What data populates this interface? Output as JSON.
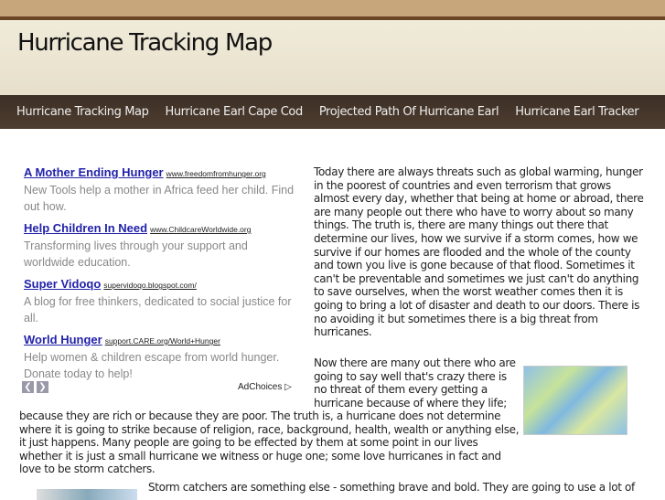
{
  "site": {
    "title": "Hurricane Tracking Map"
  },
  "nav": [
    "Hurricane Tracking Map",
    "Hurricane Earl Cape Cod",
    "Projected Path Of Hurricane Earl",
    "Hurricane Earl Tracker"
  ],
  "ads": [
    {
      "title": "A Mother Ending Hunger",
      "url": "www.freedomfromhunger.org",
      "desc": "New Tools help a mother in Africa feed her child. Find out how."
    },
    {
      "title": "Help Children In Need",
      "url": "www.ChildcareWorldwide.org",
      "desc": "Transforming lives through your support and worldwide education."
    },
    {
      "title": "Super Vidoqo",
      "url": "supervidoqo.blogspot.com/",
      "desc": "A blog for free thinkers, dedicated to social justice for all."
    },
    {
      "title": "World Hunger",
      "url": "support.CARE.org/World+Hunger",
      "desc": "Help women & children escape from world hunger. Donate today to help!"
    }
  ],
  "adchoices": "AdChoices",
  "article": {
    "p1": "Today there are always threats such as global warming, hunger in the poorest of countries and even terrorism that grows almost every day, whether that being at home or abroad, there are many people out there who have to worry about so many things. The truth is, there are many things out there that determine our lives, how we survive if a storm comes, how we survive if our homes are flooded and the whole of the county and town you live is gone because of that flood. Sometimes it can't be preventable and sometimes we just can't do anything to save ourselves, when the worst weather comes then it is going to bring a lot of disaster and death to our doors. There is no avoiding it but sometimes there is a big threat from hurricanes.",
    "p2a": "Now there are many out there who are going to say well that's crazy there is no threat of them every getting a hurricane because of where they life;",
    "p2b": "because they are rich or because they are poor. The truth is, a hurricane does not determine where it is going to strike because of religion, race, background, health, wealth or anything else, it just happens. Many people are going to be effected by them at some point in our lives whether it is just a small hurricane we witness or huge one; some love hurricanes in fact and love to be storm catchers.",
    "p3": "Storm catchers are something else - something brave and bold. They are going to use a lot of"
  }
}
